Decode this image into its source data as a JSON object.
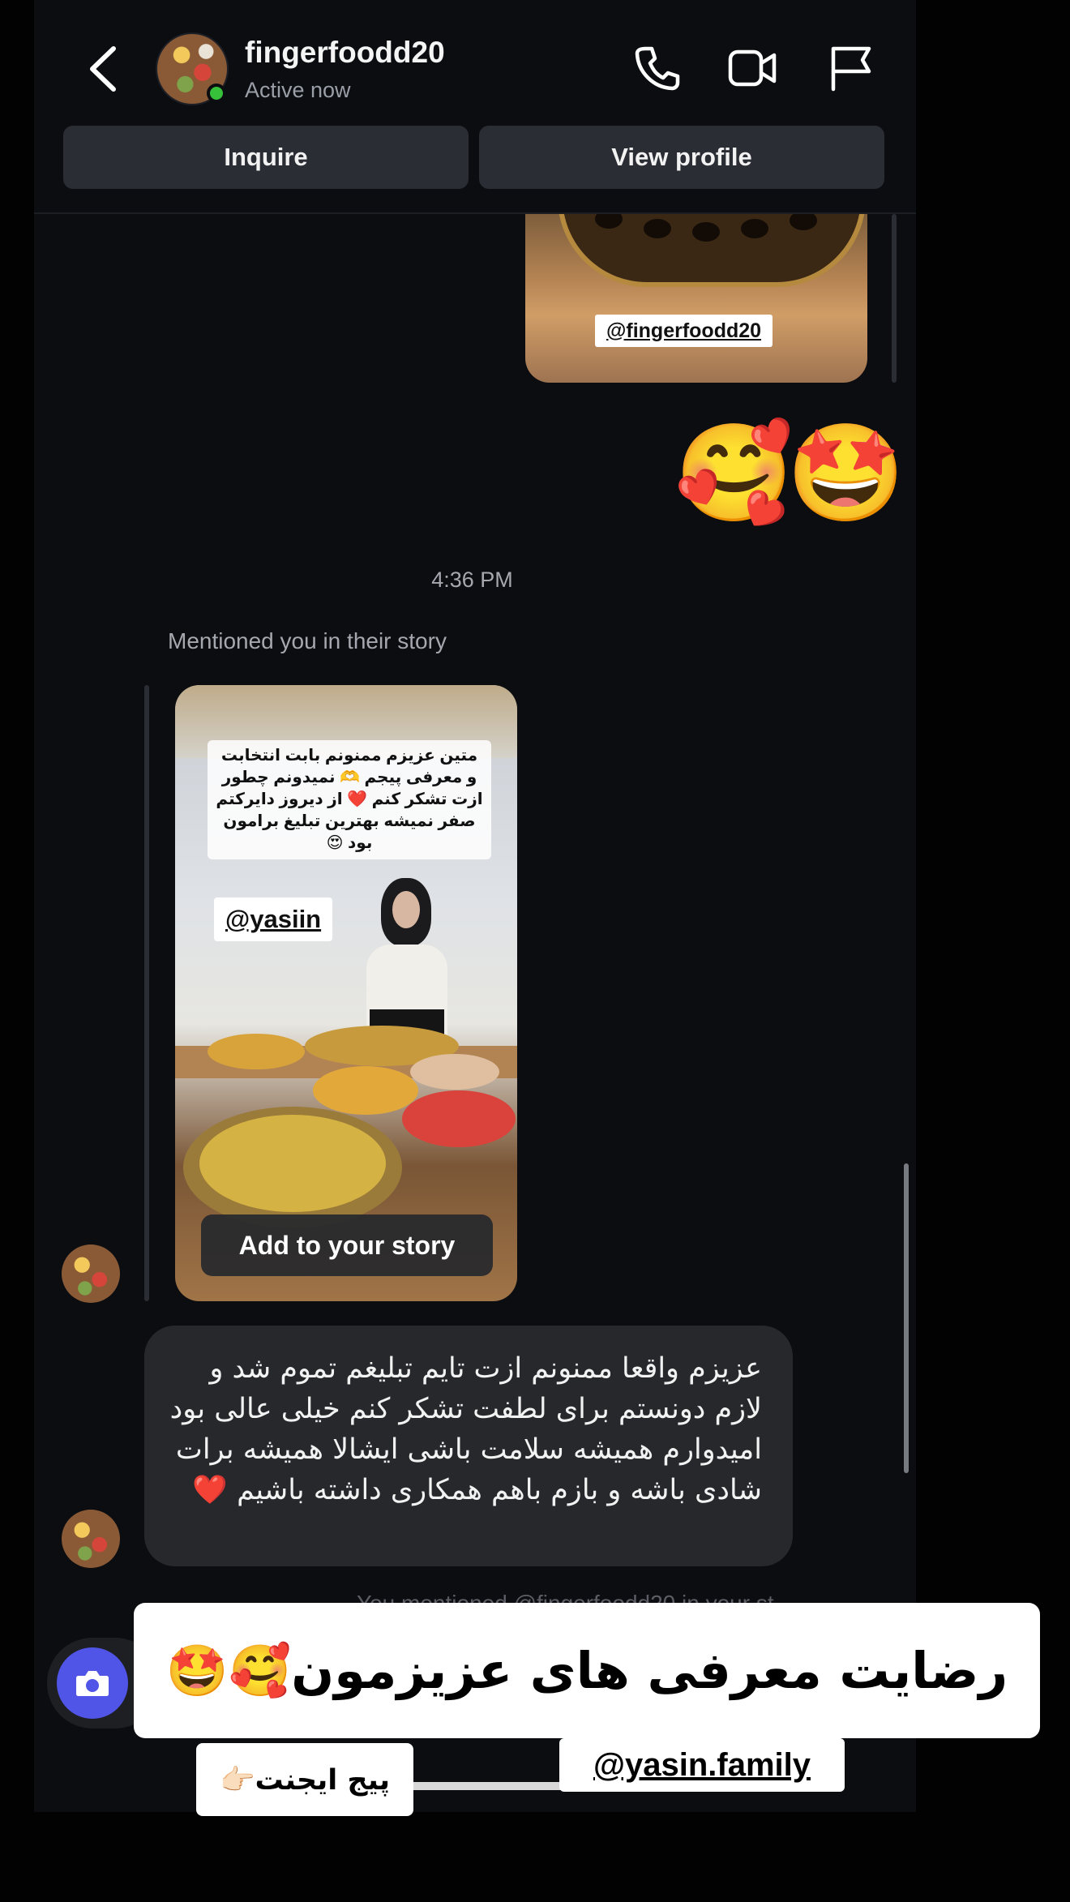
{
  "header": {
    "username": "fingerfoodd20",
    "status": "Active now",
    "buttons": {
      "inquire": "Inquire",
      "view_profile": "View profile"
    },
    "icons": [
      "back-icon",
      "phone-icon",
      "video-icon",
      "flag-icon"
    ]
  },
  "thread": {
    "shared_post_handle": "@fingerfoodd20",
    "emoji_reaction": "☺️🤩",
    "emoji_left": "🥰",
    "emoji_right": "🤩",
    "timestamp": "4:36 PM",
    "mention_note": "Mentioned you in their story",
    "story": {
      "caption": "متین عزیزم ممنونم بابت انتخابت و معرفی پیجم 🫶 نمیدونم چطور ازت تشکر کنم ❤️ از دیروز دایرکتم صفر نمیشه بهترین تبلیغ برامون بود 😍",
      "mention": "@yasiin",
      "add_button": "Add to your story"
    },
    "message": "عزیزم واقعا ممنونم ازت تایم تبلیغم تموم شد و لازم دونستم برای لطفت تشکر کنم خیلی عالی بود امیدوارم همیشه سلامت باشی ایشالا همیشه برات شادی باشه و بازم باهم همکاری داشته باشیم ❤️",
    "partial_text": "You mentioned @fingerfoodd20 in your st"
  },
  "overlay": {
    "banner": "رضایت معرفی های عزیزمون🥰🤩",
    "sticker_agent": "پیج ایجنت👉🏻",
    "sticker_handle": "@yasin.family"
  },
  "colors": {
    "background": "#0b0d11",
    "button": "#2a2d33",
    "bubble": "#26282c",
    "online": "#37c13b",
    "camera": "#5055e8"
  }
}
